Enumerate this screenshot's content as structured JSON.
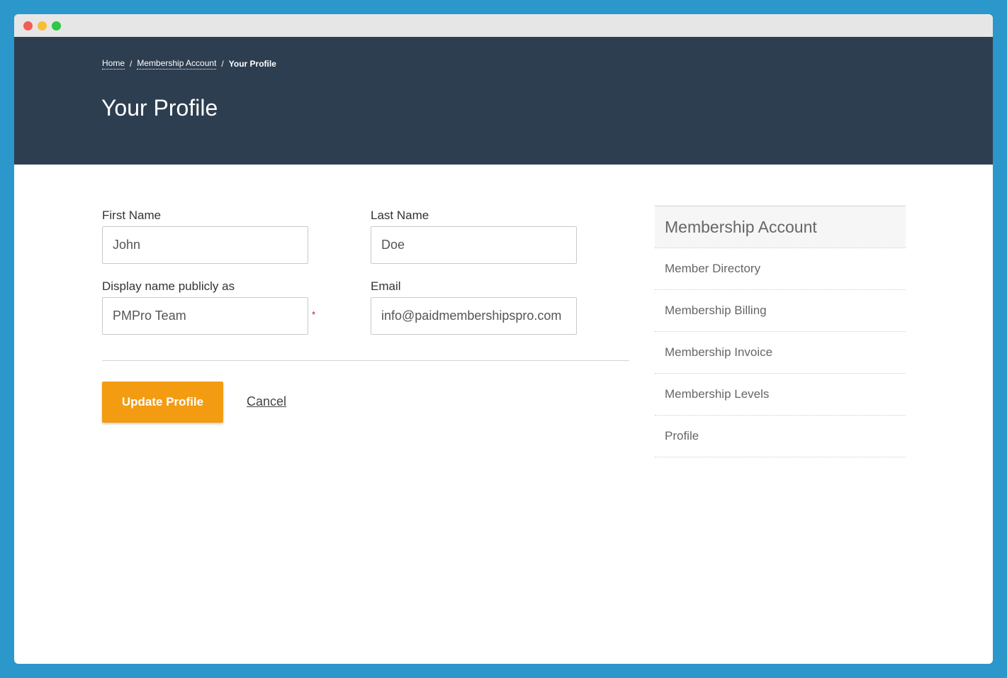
{
  "breadcrumb": {
    "home": "Home",
    "separator": "/",
    "account": "Membership Account",
    "current": "Your Profile"
  },
  "header": {
    "title": "Your Profile"
  },
  "form": {
    "first_name_label": "First Name",
    "first_name_value": "John",
    "last_name_label": "Last Name",
    "last_name_value": "Doe",
    "display_name_label": "Display name publicly as",
    "display_name_value": "PMPro Team",
    "required_marker": "*",
    "email_label": "Email",
    "email_value": "info@paidmembershipspro.com",
    "update_label": "Update Profile",
    "cancel_label": "Cancel"
  },
  "sidebar": {
    "title": "Membership Account",
    "items": [
      {
        "label": "Member Directory"
      },
      {
        "label": "Membership Billing"
      },
      {
        "label": "Membership Invoice"
      },
      {
        "label": "Membership Levels"
      },
      {
        "label": "Profile"
      }
    ]
  },
  "colors": {
    "background": "#2b97cb",
    "header": "#2e3e51",
    "accent": "#f39c12"
  }
}
